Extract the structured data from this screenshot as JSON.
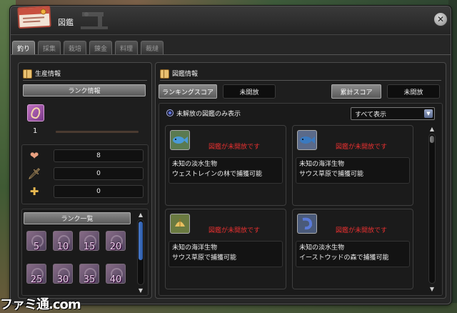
{
  "window": {
    "title": "図鑑",
    "close_glyph": "✕"
  },
  "tabs": [
    {
      "label": "釣り",
      "active": true
    },
    {
      "label": "採集",
      "active": false
    },
    {
      "label": "栽培",
      "active": false
    },
    {
      "label": "錬金",
      "active": false
    },
    {
      "label": "料理",
      "active": false
    },
    {
      "label": "裁縫",
      "active": false
    }
  ],
  "production": {
    "header": "生産情報",
    "rank_info_button": "ランク情報",
    "rank_level": "1",
    "stats": [
      {
        "icon": "heart-icon",
        "glyph": "❤",
        "value": "8"
      },
      {
        "icon": "sword-icon",
        "glyph": "🗡",
        "value": "0"
      },
      {
        "icon": "shield-plus-icon",
        "glyph": "✚",
        "value": "0"
      }
    ],
    "rank_list_header": "ランク一覧",
    "rank_list": [
      "5",
      "10",
      "15",
      "20",
      "25",
      "30",
      "35",
      "40"
    ]
  },
  "encyclopedia": {
    "header": "図鑑情報",
    "ranking_score_label": "ランキングスコア",
    "ranking_score_value": "未開放",
    "total_score_label": "累計スコア",
    "total_score_value": "未開放",
    "filter_label": "未解放の図鑑のみ表示",
    "dropdown_value": "すべて表示",
    "entries": [
      {
        "status": "図鑑が未開放です",
        "line1": "未知の淡水生物",
        "line2": "ウェストレインの林で捕獲可能",
        "color": "#4a9ad8"
      },
      {
        "status": "図鑑が未開放です",
        "line1": "未知の海洋生物",
        "line2": "サウス草原で捕獲可能",
        "color": "#3a7ac0"
      },
      {
        "status": "図鑑が未開放です",
        "line1": "未知の海洋生物",
        "line2": "サウス草原で捕獲可能",
        "color": "#e8c060"
      },
      {
        "status": "図鑑が未開放です",
        "line1": "未知の淡水生物",
        "line2": "イーストウッドの森で捕獲可能",
        "color": "#5a7ad8"
      }
    ]
  },
  "watermark": "ファミ通.com"
}
